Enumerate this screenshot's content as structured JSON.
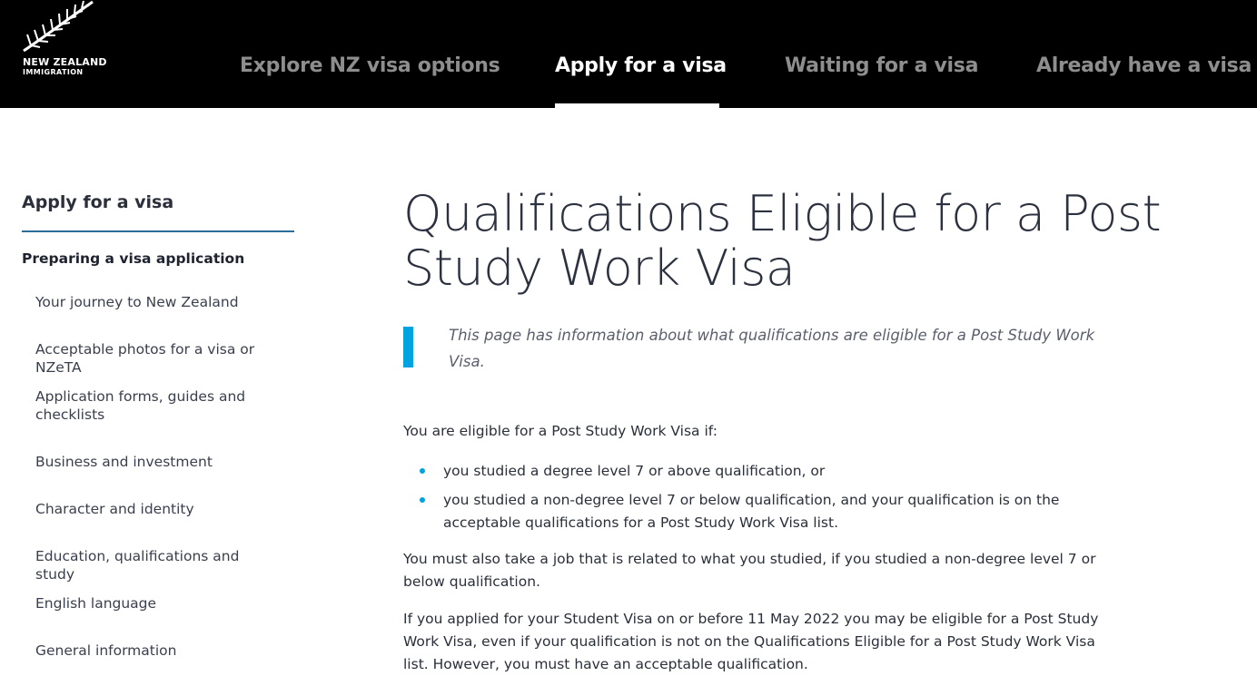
{
  "logo": {
    "line1": "NEW ZEALAND",
    "line2": "IMMIGRATION"
  },
  "nav": {
    "items": [
      {
        "label": "Explore NZ visa options",
        "active": false
      },
      {
        "label": "Apply for a visa",
        "active": true
      },
      {
        "label": "Waiting for a visa",
        "active": false
      },
      {
        "label": "Already have a visa",
        "active": false
      }
    ]
  },
  "sidebar": {
    "title": "Apply for a visa",
    "section": "Preparing a visa application",
    "links": [
      "Your journey to New Zealand",
      "Acceptable photos for a visa or NZeTA",
      "Application forms, guides and checklists",
      "Business and investment",
      "Character and identity",
      "Education, qualifications and study",
      "English language",
      "General information"
    ]
  },
  "main": {
    "title": "Qualifications Eligible for a Post Study Work Visa",
    "intro": "This page has information about what qualifications are eligible for a Post Study Work Visa.",
    "eligible_lead": "You are eligible for a Post Study Work Visa if:",
    "bullets": [
      "you studied a degree level 7 or above qualification, or",
      "you studied a non-degree level 7 or below qualification, and your qualification is on the acceptable qualifications for a Post Study Work Visa list."
    ],
    "para_job": "You must also take a job that is related to what you studied, if you studied a non-degree level 7 or below qualification.",
    "para_student": "If you applied for your Student Visa on or before 11 May 2022 you may be eligible for a Post Study Work Visa, even if your qualification is not on the Qualifications Eligible for a Post Study Work Visa list. However, you must have an acceptable qualification."
  },
  "colors": {
    "header_bg": "#000000",
    "nav_inactive": "#8e8e8e",
    "nav_active": "#ffffff",
    "accent_blue": "#00a3e0",
    "sidebar_rule": "#2b6e98"
  },
  "icons": {
    "logo": "silver-fern-icon",
    "bullet": "bullet-dot-icon"
  }
}
